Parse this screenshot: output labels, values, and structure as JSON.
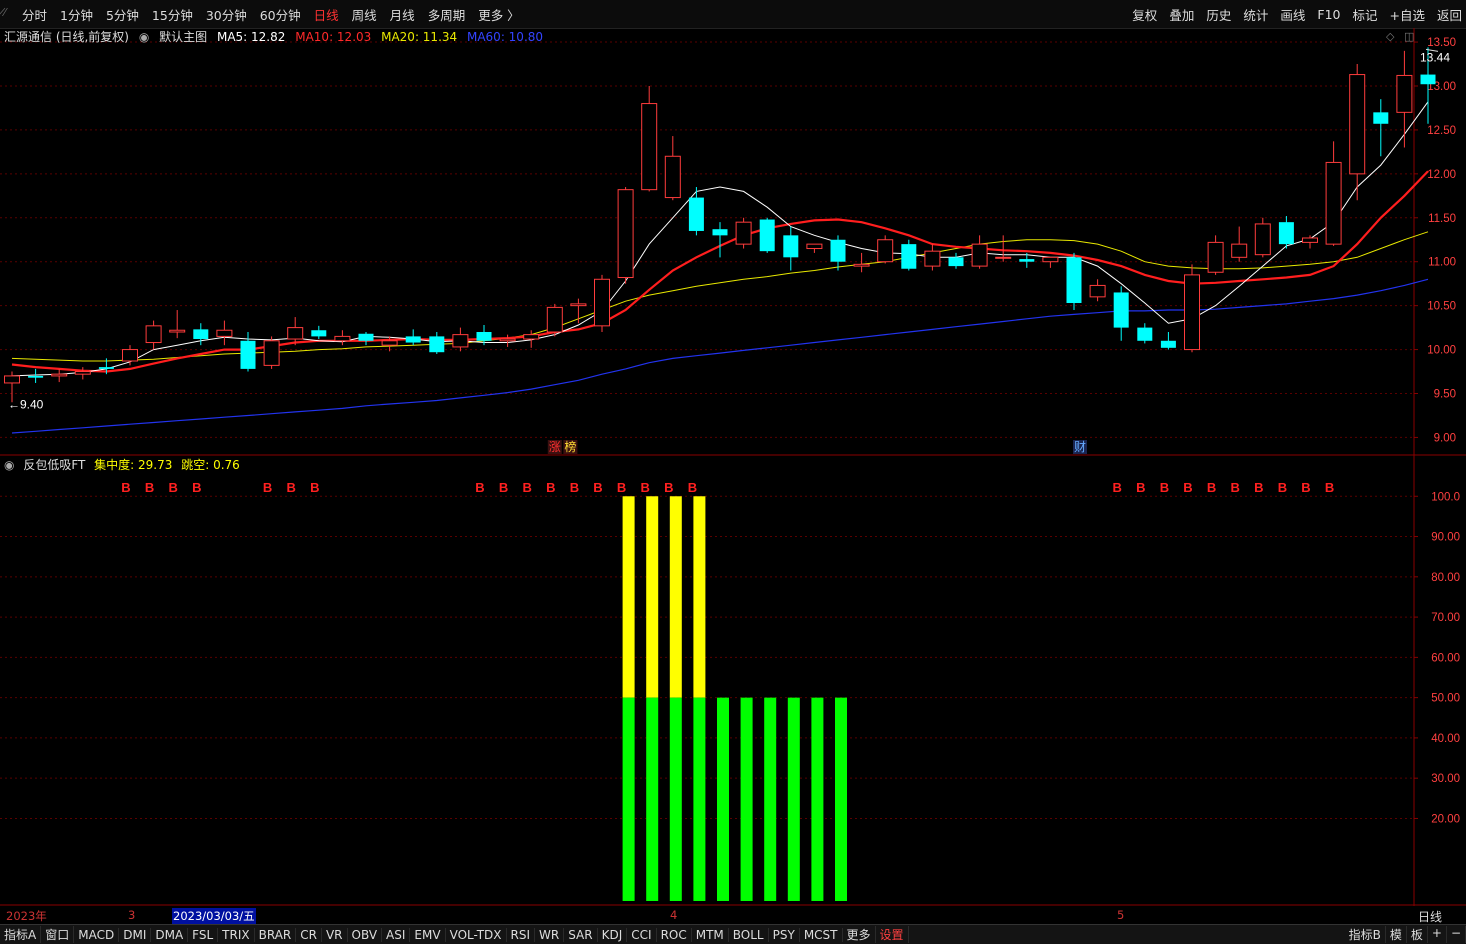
{
  "topbar": {
    "system_icon": "restore-icon",
    "periods": [
      "分时",
      "1分钟",
      "5分钟",
      "15分钟",
      "30分钟",
      "60分钟",
      "日线",
      "周线",
      "月线",
      "多周期",
      "更多 〉"
    ],
    "active_period": "日线",
    "tools": [
      "复权",
      "叠加",
      "历史",
      "统计",
      "画线",
      "F10",
      "标记",
      "+自选",
      "返回"
    ]
  },
  "main_pane": {
    "stock_title": "汇源通信 (日线,前复权)",
    "template_icon": "circle-dot-icon",
    "template_label": "默认主图",
    "ma": [
      {
        "label": "MA5: 12.82",
        "color": "#ffffff"
      },
      {
        "label": "MA10: 12.03",
        "color": "#ff2a2a"
      },
      {
        "label": "MA20: 11.34",
        "color": "#e8e800"
      },
      {
        "label": "MA60: 10.80",
        "color": "#3344ff"
      }
    ],
    "high_label": "13.44",
    "low_label": "9.40",
    "markers": [
      {
        "text": "涨",
        "color": "#ff3030",
        "bg": "#3a1010"
      },
      {
        "text": "榜",
        "color": "#ffdd33",
        "bg": "#3a1010"
      },
      {
        "text": "财",
        "color": "#66aaff",
        "bg": "#1a2550"
      }
    ],
    "y_ticks": [
      "13.50",
      "13.00",
      "12.50",
      "12.00",
      "11.50",
      "11.00",
      "10.50",
      "10.00",
      "9.50",
      "9.00"
    ]
  },
  "indicator_pane": {
    "name": "反包低吸FT",
    "concentration": "集中度: 29.73",
    "gap": "跳空: 0.76",
    "b_label": "B",
    "y_ticks": [
      "100.0",
      "90.00",
      "80.00",
      "70.00",
      "60.00",
      "50.00",
      "40.00",
      "30.00",
      "20.00"
    ]
  },
  "datebar": {
    "year": "2023年",
    "month_3": "3",
    "selected_date": "2023/03/03/五",
    "month_4": "4",
    "month_5": "5",
    "period_label": "日线"
  },
  "bottombar": {
    "left": [
      "指标A",
      "窗口",
      "MACD",
      "DMI",
      "DMA",
      "FSL",
      "TRIX",
      "BRAR",
      "CR",
      "VR",
      "OBV",
      "ASI",
      "EMV",
      "VOL-TDX",
      "RSI",
      "WR",
      "SAR",
      "KDJ",
      "CCI",
      "ROC",
      "MTM",
      "BOLL",
      "PSY",
      "MCST",
      "更多",
      "设置"
    ],
    "right": [
      "指标B",
      "模",
      "板",
      "+",
      "−"
    ]
  },
  "chart_data": {
    "type": "candlestick",
    "ohlc": [
      [
        9.62,
        9.75,
        9.4,
        9.7
      ],
      [
        9.7,
        9.78,
        9.62,
        9.68
      ],
      [
        9.7,
        9.78,
        9.63,
        9.72
      ],
      [
        9.72,
        9.8,
        9.66,
        9.75
      ],
      [
        9.8,
        9.9,
        9.72,
        9.78
      ],
      [
        9.87,
        10.05,
        9.82,
        10.0
      ],
      [
        10.08,
        10.33,
        10.0,
        10.27
      ],
      [
        10.2,
        10.45,
        10.13,
        10.22
      ],
      [
        10.23,
        10.3,
        10.05,
        10.12
      ],
      [
        10.15,
        10.33,
        10.05,
        10.22
      ],
      [
        10.1,
        10.2,
        9.75,
        9.78
      ],
      [
        9.82,
        10.15,
        9.78,
        10.1
      ],
      [
        10.12,
        10.37,
        10.05,
        10.25
      ],
      [
        10.22,
        10.27,
        10.12,
        10.15
      ],
      [
        10.1,
        10.22,
        10.05,
        10.15
      ],
      [
        10.18,
        10.2,
        10.05,
        10.1
      ],
      [
        10.05,
        10.15,
        9.98,
        10.1
      ],
      [
        10.15,
        10.23,
        10.05,
        10.08
      ],
      [
        10.15,
        10.2,
        9.95,
        9.97
      ],
      [
        10.03,
        10.25,
        9.98,
        10.17
      ],
      [
        10.2,
        10.28,
        10.05,
        10.1
      ],
      [
        10.1,
        10.17,
        10.03,
        10.12
      ],
      [
        10.12,
        10.22,
        10.02,
        10.17
      ],
      [
        10.2,
        10.52,
        10.15,
        10.48
      ],
      [
        10.5,
        10.58,
        10.3,
        10.52
      ],
      [
        10.27,
        10.85,
        10.2,
        10.8
      ],
      [
        10.82,
        11.85,
        10.75,
        11.82
      ],
      [
        11.82,
        13.0,
        11.8,
        12.8
      ],
      [
        11.73,
        12.43,
        11.7,
        12.2
      ],
      [
        11.73,
        11.85,
        11.3,
        11.35
      ],
      [
        11.37,
        11.45,
        11.05,
        11.3
      ],
      [
        11.2,
        11.5,
        11.15,
        11.45
      ],
      [
        11.48,
        11.5,
        11.1,
        11.12
      ],
      [
        11.3,
        11.4,
        10.9,
        11.05
      ],
      [
        11.15,
        11.2,
        11.1,
        11.2
      ],
      [
        11.25,
        11.3,
        10.9,
        11.0
      ],
      [
        10.95,
        11.1,
        10.88,
        10.97
      ],
      [
        11.0,
        11.3,
        10.98,
        11.25
      ],
      [
        11.2,
        11.25,
        10.9,
        10.92
      ],
      [
        10.95,
        11.2,
        10.9,
        11.12
      ],
      [
        11.05,
        11.1,
        10.92,
        10.95
      ],
      [
        10.95,
        11.3,
        10.92,
        11.2
      ],
      [
        11.05,
        11.3,
        11.0,
        11.05
      ],
      [
        11.03,
        11.1,
        10.93,
        11.0
      ],
      [
        11.0,
        11.05,
        10.93,
        11.05
      ],
      [
        11.05,
        11.1,
        10.45,
        10.53
      ],
      [
        10.6,
        10.8,
        10.55,
        10.73
      ],
      [
        10.65,
        10.72,
        10.1,
        10.25
      ],
      [
        10.25,
        10.3,
        10.07,
        10.1
      ],
      [
        10.1,
        10.2,
        10.0,
        10.02
      ],
      [
        10.0,
        10.97,
        9.97,
        10.85
      ],
      [
        10.88,
        11.3,
        10.85,
        11.22
      ],
      [
        11.05,
        11.4,
        11.0,
        11.2
      ],
      [
        11.08,
        11.5,
        11.05,
        11.43
      ],
      [
        11.45,
        11.52,
        11.15,
        11.2
      ],
      [
        11.22,
        11.3,
        11.15,
        11.27
      ],
      [
        11.2,
        12.37,
        11.18,
        12.13
      ],
      [
        12.0,
        13.25,
        11.7,
        13.13
      ],
      [
        12.7,
        12.85,
        12.2,
        12.57
      ],
      [
        12.7,
        13.4,
        12.3,
        13.12
      ],
      [
        13.13,
        13.44,
        12.57,
        13.02
      ]
    ],
    "ma5": [
      9.7,
      9.71,
      9.72,
      9.74,
      9.78,
      9.86,
      10.0,
      10.05,
      10.1,
      10.14,
      10.12,
      10.11,
      10.13,
      10.1,
      10.09,
      10.15,
      10.14,
      10.12,
      10.09,
      10.1,
      10.08,
      10.08,
      10.11,
      10.17,
      10.28,
      10.44,
      10.78,
      11.2,
      11.5,
      11.8,
      11.85,
      11.8,
      11.62,
      11.4,
      11.3,
      11.22,
      11.15,
      11.1,
      11.09,
      11.05,
      11.05,
      11.1,
      11.08,
      11.08,
      11.05,
      11.05,
      10.95,
      10.75,
      10.53,
      10.3,
      10.35,
      10.5,
      10.72,
      10.95,
      11.18,
      11.26,
      11.45,
      11.85,
      12.1,
      12.45,
      12.82
    ],
    "ma10": [
      9.83,
      9.8,
      9.78,
      9.76,
      9.75,
      9.78,
      9.84,
      9.9,
      9.95,
      10.0,
      10.0,
      10.04,
      10.08,
      10.1,
      10.1,
      10.1,
      10.11,
      10.12,
      10.11,
      10.11,
      10.12,
      10.13,
      10.15,
      10.2,
      10.23,
      10.3,
      10.45,
      10.68,
      10.9,
      11.05,
      11.18,
      11.3,
      11.38,
      11.43,
      11.47,
      11.48,
      11.45,
      11.38,
      11.3,
      11.2,
      11.17,
      11.15,
      11.13,
      11.12,
      11.1,
      11.07,
      11.02,
      10.95,
      10.85,
      10.78,
      10.75,
      10.76,
      10.78,
      10.8,
      10.82,
      10.85,
      10.95,
      11.2,
      11.5,
      11.75,
      12.03
    ],
    "ma20": [
      9.9,
      9.89,
      9.88,
      9.87,
      9.87,
      9.88,
      9.89,
      9.91,
      9.93,
      9.95,
      9.96,
      9.97,
      9.98,
      10.0,
      10.01,
      10.03,
      10.04,
      10.05,
      10.06,
      10.07,
      10.1,
      10.13,
      10.17,
      10.25,
      10.35,
      10.45,
      10.55,
      10.62,
      10.67,
      10.72,
      10.76,
      10.8,
      10.83,
      10.87,
      10.9,
      10.94,
      10.97,
      11.0,
      11.05,
      11.1,
      11.15,
      11.2,
      11.23,
      11.25,
      11.25,
      11.24,
      11.2,
      11.12,
      11.0,
      10.95,
      10.93,
      10.92,
      10.92,
      10.93,
      10.95,
      10.97,
      11.0,
      11.05,
      11.15,
      11.25,
      11.34
    ],
    "ma60": [
      9.05,
      9.07,
      9.09,
      9.11,
      9.13,
      9.15,
      9.17,
      9.19,
      9.21,
      9.23,
      9.25,
      9.27,
      9.29,
      9.31,
      9.33,
      9.36,
      9.38,
      9.4,
      9.42,
      9.45,
      9.48,
      9.51,
      9.55,
      9.6,
      9.65,
      9.72,
      9.78,
      9.85,
      9.9,
      9.93,
      9.96,
      9.99,
      10.02,
      10.05,
      10.08,
      10.11,
      10.14,
      10.17,
      10.2,
      10.23,
      10.26,
      10.29,
      10.32,
      10.35,
      10.38,
      10.4,
      10.42,
      10.44,
      10.44,
      10.45,
      10.45,
      10.46,
      10.48,
      10.5,
      10.52,
      10.55,
      10.58,
      10.62,
      10.67,
      10.73,
      10.8
    ],
    "y_range_main": [
      8.8,
      13.66
    ],
    "indicator": {
      "b_signals": [
        5,
        6,
        7,
        8,
        11,
        12,
        13,
        20,
        21,
        22,
        23,
        24,
        25,
        26,
        27,
        28,
        29,
        47,
        48,
        49,
        50,
        51,
        52,
        53,
        54,
        55,
        56
      ],
      "bars": [
        {
          "index": 26,
          "green": 50,
          "yellow": 100
        },
        {
          "index": 27,
          "green": 50,
          "yellow": 100
        },
        {
          "index": 28,
          "green": 50,
          "yellow": 100
        },
        {
          "index": 29,
          "green": 50,
          "yellow": 100
        },
        {
          "index": 30,
          "green": 50
        },
        {
          "index": 31,
          "green": 50
        },
        {
          "index": 32,
          "green": 50
        },
        {
          "index": 33,
          "green": 50
        },
        {
          "index": 34,
          "green": 50
        },
        {
          "index": 35,
          "green": 50
        }
      ],
      "y_range": [
        0,
        110
      ]
    }
  },
  "colors": {
    "up": "#ff3c3c",
    "down": "#00ffff",
    "grid": "#5a0000",
    "axis_text": "#ff4040"
  }
}
